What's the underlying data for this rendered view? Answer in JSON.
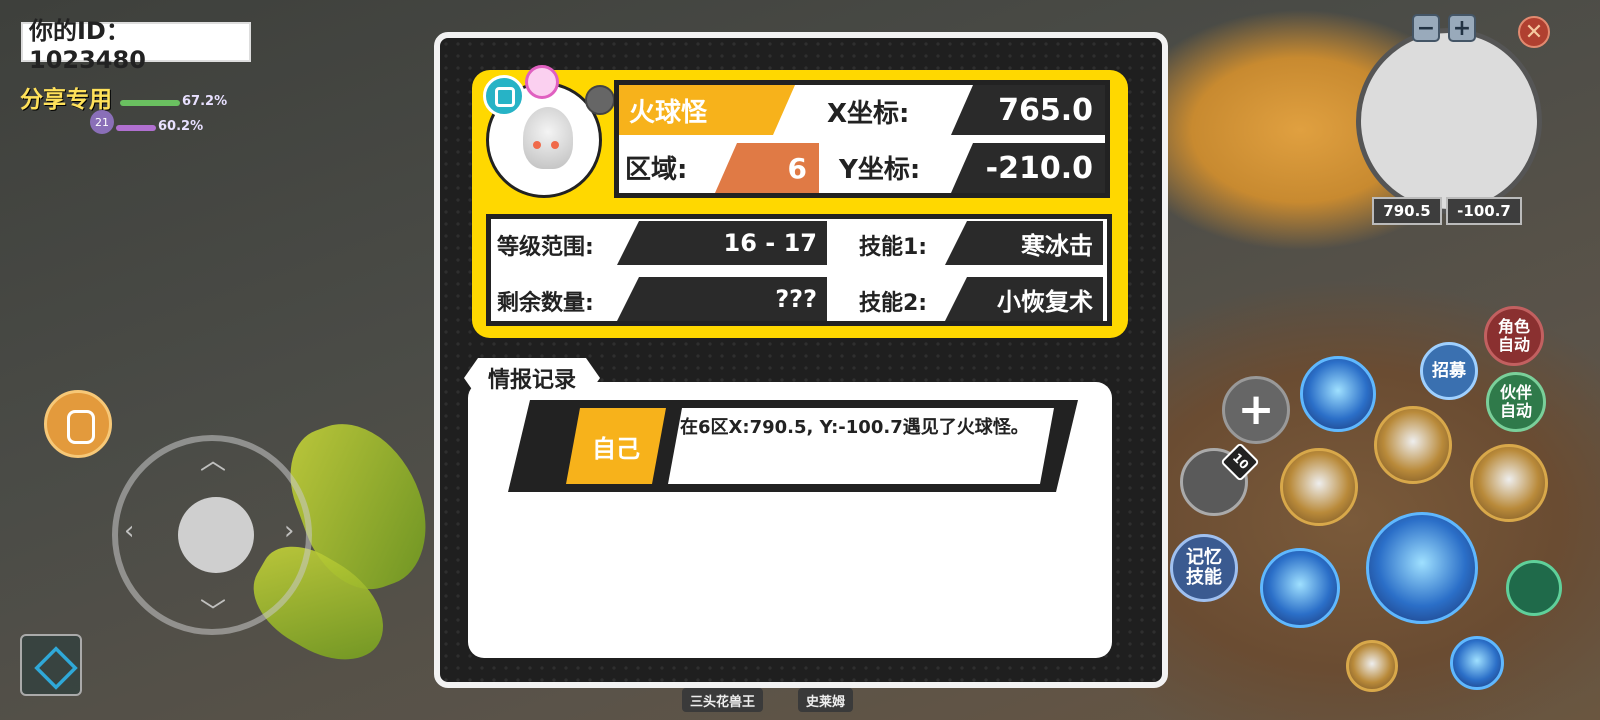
{
  "hud": {
    "player_id": "你的ID：  1023480",
    "share_label": "分享专用",
    "stat_pct_1": "67.2%",
    "stat_pct_2": "60.2%",
    "level_badge": "21"
  },
  "minimap": {
    "zoom_out": "−",
    "zoom_in": "+",
    "close": "✕",
    "coord_x": "790.5",
    "coord_y": "-100.7"
  },
  "right_controls": {
    "role_auto": "角色\n自动",
    "recruit": "招募",
    "partner_auto": "伙伴\n自动",
    "memory_skill": "记忆\n技能",
    "potion_count": "10",
    "add": "+"
  },
  "bottom_tags": [
    "三头花兽王",
    "史莱姆"
  ],
  "monster": {
    "name": "火球怪",
    "region_label": "区域:",
    "region_value": "6",
    "x_label": "X坐标:",
    "x_value": "765.0",
    "y_label": "Y坐标:",
    "y_value": "-210.0"
  },
  "stats": {
    "level_label": "等级范围:",
    "level_value": "16 - 17",
    "skill1_label": "技能1:",
    "skill1_value": "寒冰击",
    "remaining_label": "剩余数量:",
    "remaining_value": "???",
    "skill2_label": "技能2:",
    "skill2_value": "小恢复术"
  },
  "record": {
    "tab_label": "情报记录",
    "entries": [
      {
        "who": "自己",
        "text": "在6区X:790.5, Y:-100.7遇见了火球怪。"
      }
    ]
  },
  "colors": {
    "panel_yellow": "#ffd800",
    "name_orange": "#f7b21b",
    "region_orange": "#e07a45",
    "dark_cell": "#2a2a2a"
  }
}
